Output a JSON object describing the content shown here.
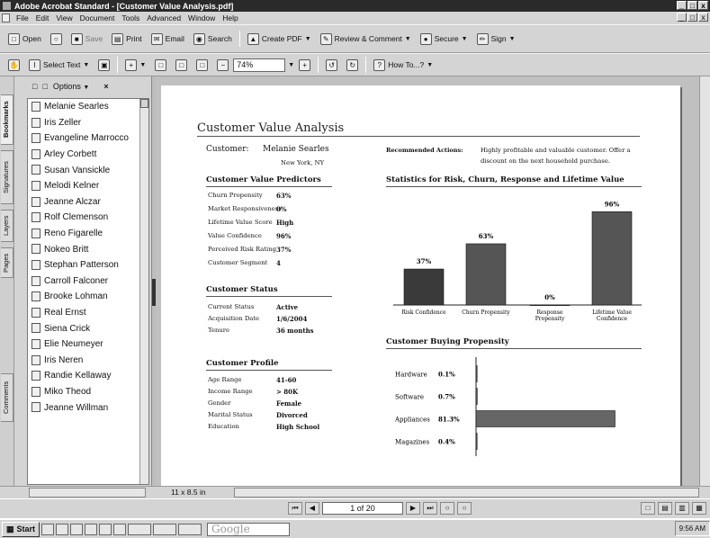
{
  "window": {
    "title": "Adobe Acrobat Standard - [Customer Value Analysis.pdf]",
    "controls": [
      "_",
      "□",
      "x"
    ]
  },
  "menu": [
    "File",
    "Edit",
    "View",
    "Document",
    "Tools",
    "Advanced",
    "Window",
    "Help"
  ],
  "toolbar1": {
    "open": "Open",
    "save": "Save",
    "print": "Print",
    "email": "Email",
    "search": "Search",
    "create_pdf": "Create PDF",
    "review": "Review & Comment",
    "secure": "Secure",
    "sign": "Sign"
  },
  "toolbar2": {
    "select_text": "Select Text",
    "zoom": "74%",
    "how_to": "How To...?"
  },
  "side_tabs": [
    "Bookmarks",
    "Signatures",
    "Layers",
    "Pages",
    "Comments"
  ],
  "bookmarks": {
    "options": "Options",
    "items": [
      "Melanie Searles",
      "Iris Zeller",
      "Evangeline Marrocco",
      "Arley Corbett",
      "Susan Vansickle",
      "Melodi Kelner",
      "Jeanne Alczar",
      "Rolf Clemenson",
      "Reno Figarelle",
      "Nokeo Britt",
      "Stephan Patterson",
      "Carroll Falconer",
      "Brooke Lohman",
      "Real Ernst",
      "Siena Crick",
      "Elie Neumeyer",
      "Iris Neren",
      "Randie Kellaway",
      "Miko Theod",
      "Jeanne Willman"
    ]
  },
  "doc": {
    "title": "Customer Value Analysis",
    "customer_label": "Customer:",
    "customer_name": "Melanie Searles",
    "customer_location": "New York, NY",
    "recommended_label": "Recommended Actions:",
    "recommended_text_1": "Highly profitable and valuable customer.  Offer a",
    "recommended_text_2": "discount on the next household purchase.",
    "predictors": {
      "heading": "Customer Value Predictors",
      "rows": [
        {
          "label": "Churn Propensity",
          "value": "63%"
        },
        {
          "label": "Market Responsiveness",
          "value": "0%"
        },
        {
          "label": "Lifetime Value Score",
          "value": "High"
        },
        {
          "label": "Value Confidence",
          "value": "96%"
        },
        {
          "label": "Perceived Risk Rating",
          "value": "37%"
        },
        {
          "label": "Customer Segment",
          "value": "4"
        }
      ]
    },
    "status": {
      "heading": "Customer Status",
      "rows": [
        {
          "label": "Current Status",
          "value": "Active"
        },
        {
          "label": "Acquisition Date",
          "value": "1/6/2004"
        },
        {
          "label": "Tenure",
          "value": "36 months"
        }
      ]
    },
    "profile": {
      "heading": "Customer Profile",
      "rows": [
        {
          "label": "Age Range",
          "value": "41-60"
        },
        {
          "label": "Income Range",
          "value": "> 80K"
        },
        {
          "label": "Gender",
          "value": "Female"
        },
        {
          "label": "Marital Status",
          "value": "Divorced"
        },
        {
          "label": "Education",
          "value": "High School"
        }
      ]
    }
  },
  "chart_data": [
    {
      "type": "bar",
      "title": "Statistics for Risk, Churn, Response and Lifetime Value",
      "categories": [
        "Risk Confidence",
        "Churn Propensity",
        "Response Propensity",
        "Lifetime Value Confidence"
      ],
      "values": [
        37,
        63,
        0,
        96
      ],
      "value_labels": [
        "37%",
        "63%",
        "0%",
        "96%"
      ],
      "ylim": [
        0,
        100
      ],
      "grid": false,
      "colors": [
        "#3a3a3a",
        "#555555",
        "#555555",
        "#555555"
      ]
    },
    {
      "type": "bar",
      "orientation": "horizontal",
      "title": "Customer Buying Propensity",
      "categories": [
        "Hardware",
        "Software",
        "Appliances",
        "Magazines"
      ],
      "values": [
        0.1,
        0.7,
        81.3,
        0.4
      ],
      "value_labels": [
        "0.1%",
        "0.7%",
        "81.3%",
        "0.4%"
      ],
      "xlim": [
        0,
        100
      ],
      "grid": false,
      "colors": [
        "#666666"
      ]
    }
  ],
  "status": {
    "page_size": "11 x 8.5 in"
  },
  "nav": {
    "page": "1 of 20"
  },
  "taskbar": {
    "start": "Start",
    "google": "Google",
    "clock": "9:56 AM"
  }
}
